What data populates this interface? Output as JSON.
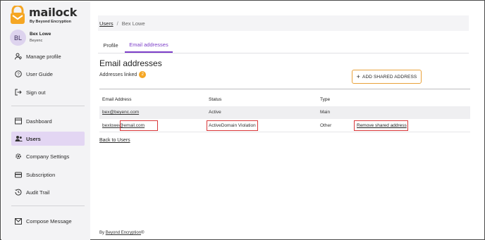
{
  "brand": {
    "name": "mailock",
    "tagline": "By Beyond Encryption",
    "accent": "#f5a623",
    "purple": "#7d3fc9"
  },
  "user": {
    "initials": "BL",
    "name": "Bex Lowe",
    "org": "Beyenc"
  },
  "sidebar": {
    "top_items": [
      {
        "label": "Manage profile",
        "icon": "person-gear-icon"
      },
      {
        "label": "User Guide",
        "icon": "question-circle-icon"
      },
      {
        "label": "Sign out",
        "icon": "sign-out-icon"
      }
    ],
    "main_items": [
      {
        "label": "Dashboard",
        "icon": "dashboard-icon"
      },
      {
        "label": "Users",
        "icon": "users-icon",
        "active": true
      },
      {
        "label": "Company Settings",
        "icon": "gear-icon"
      },
      {
        "label": "Subscription",
        "icon": "credit-card-icon"
      },
      {
        "label": "Audit Trail",
        "icon": "history-icon"
      }
    ],
    "bottom_items": [
      {
        "label": "Compose Message",
        "icon": "compose-icon"
      }
    ]
  },
  "breadcrumb": {
    "root": "Users",
    "separator": "/",
    "current": "Bex Lowe"
  },
  "tabs": [
    {
      "label": "Profile"
    },
    {
      "label": "Email addresses",
      "active": true
    }
  ],
  "section": {
    "title": "Email addresses",
    "linked_label": "Addresses linked",
    "linked_count": "2"
  },
  "add_button": {
    "icon": "+",
    "label": "ADD SHARED ADDRESS"
  },
  "table": {
    "headers": [
      "Email Address",
      "Status",
      "Type"
    ],
    "rows": [
      {
        "email": "bex@beyenc.com",
        "status": "Active",
        "type": "Main",
        "action": ""
      },
      {
        "email_local": "bexlowe",
        "email_domain": "@email.com",
        "status": "ActiveDomain Violation",
        "type": "Other",
        "action": "Remove shared address"
      }
    ]
  },
  "back_link": "Back to Users",
  "footer": {
    "prefix": "By",
    "link": "Beyond Encryption",
    "suffix": "®"
  }
}
